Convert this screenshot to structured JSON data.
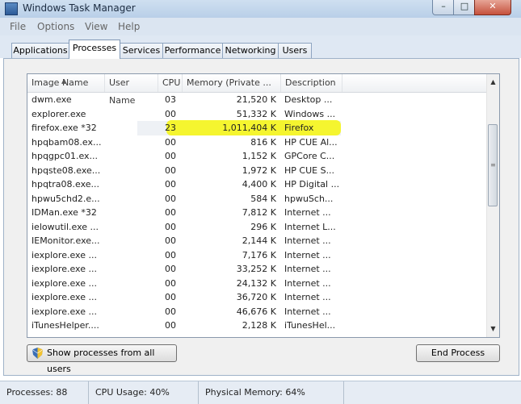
{
  "window": {
    "title": "Windows Task Manager",
    "icon": "task-manager-icon"
  },
  "menu": [
    "File",
    "Options",
    "View",
    "Help"
  ],
  "tabs": [
    "Applications",
    "Processes",
    "Services",
    "Performance",
    "Networking",
    "Users"
  ],
  "active_tab": "Processes",
  "columns": [
    "Image Name",
    "User Name",
    "CPU",
    "Memory (Private ...",
    "Description"
  ],
  "rows": [
    {
      "name": "dwm.exe",
      "user": "",
      "cpu": "03",
      "mem": "21,520 K",
      "desc": "Desktop ..."
    },
    {
      "name": "explorer.exe",
      "user": "",
      "cpu": "00",
      "mem": "51,332 K",
      "desc": "Windows ..."
    },
    {
      "name": "firefox.exe *32",
      "user": "",
      "cpu": "23",
      "mem": "1,011,404 K",
      "desc": "Firefox"
    },
    {
      "name": "hpqbam08.ex...",
      "user": "",
      "cpu": "00",
      "mem": "816 K",
      "desc": "HP CUE Al..."
    },
    {
      "name": "hpqgpc01.ex...",
      "user": "",
      "cpu": "00",
      "mem": "1,152 K",
      "desc": "GPCore C..."
    },
    {
      "name": "hpqste08.exe...",
      "user": "",
      "cpu": "00",
      "mem": "1,972 K",
      "desc": "HP CUE S..."
    },
    {
      "name": "hpqtra08.exe...",
      "user": "",
      "cpu": "00",
      "mem": "4,400 K",
      "desc": "HP Digital ..."
    },
    {
      "name": "hpwu5chd2.e...",
      "user": "",
      "cpu": "00",
      "mem": "584 K",
      "desc": "hpwuSch..."
    },
    {
      "name": "IDMan.exe *32",
      "user": "",
      "cpu": "00",
      "mem": "7,812 K",
      "desc": "Internet ..."
    },
    {
      "name": "ielowutil.exe ...",
      "user": "",
      "cpu": "00",
      "mem": "296 K",
      "desc": "Internet L..."
    },
    {
      "name": "IEMonitor.exe...",
      "user": "",
      "cpu": "00",
      "mem": "2,144 K",
      "desc": "Internet ..."
    },
    {
      "name": "iexplore.exe ...",
      "user": "",
      "cpu": "00",
      "mem": "7,176 K",
      "desc": "Internet ..."
    },
    {
      "name": "iexplore.exe ...",
      "user": "",
      "cpu": "00",
      "mem": "33,252 K",
      "desc": "Internet ..."
    },
    {
      "name": "iexplore.exe ...",
      "user": "",
      "cpu": "00",
      "mem": "24,132 K",
      "desc": "Internet ..."
    },
    {
      "name": "iexplore.exe ...",
      "user": "",
      "cpu": "00",
      "mem": "36,720 K",
      "desc": "Internet ..."
    },
    {
      "name": "iexplore.exe ...",
      "user": "",
      "cpu": "00",
      "mem": "46,676 K",
      "desc": "Internet ..."
    },
    {
      "name": "iTunesHelper....",
      "user": "",
      "cpu": "00",
      "mem": "2,128 K",
      "desc": "iTunesHel..."
    }
  ],
  "selected_row": "firefox.exe *32",
  "highlight_color": "#f5f51a",
  "buttons": {
    "show_all": "Show processes from all users",
    "end_process": "End Process"
  },
  "status": {
    "processes": "Processes: 88",
    "cpu": "CPU Usage: 40%",
    "memory": "Physical Memory: 64%"
  }
}
